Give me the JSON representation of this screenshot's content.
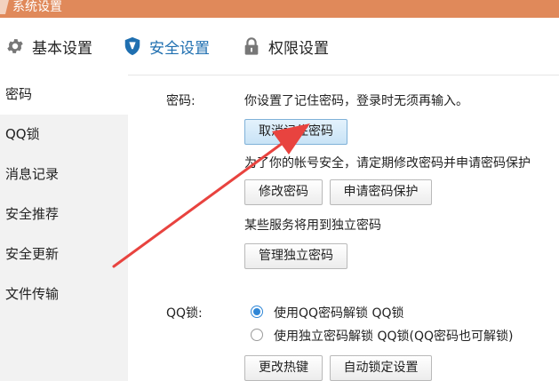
{
  "window": {
    "title": "系统设置"
  },
  "tabs": [
    {
      "label": "基本设置",
      "icon": "gear-icon"
    },
    {
      "label": "安全设置",
      "icon": "shield-icon",
      "active": true
    },
    {
      "label": "权限设置",
      "icon": "lock-icon"
    }
  ],
  "sidebar": {
    "items": [
      {
        "label": "密码",
        "active": true
      },
      {
        "label": "QQ锁"
      },
      {
        "label": "消息记录"
      },
      {
        "label": "安全推荐"
      },
      {
        "label": "安全更新"
      },
      {
        "label": "文件传输"
      }
    ]
  },
  "password": {
    "label": "密码:",
    "remembered_text": "你设置了记住密码，登录时无须再输入。",
    "cancel_remember_button": "取消记住密码",
    "security_tip": "为了你的帐号安全，请定期修改密码并申请密码保护",
    "change_password_button": "修改密码",
    "apply_protection_button": "申请密码保护",
    "independent_text": "某些服务将用到独立密码",
    "manage_independent_button": "管理独立密码"
  },
  "qqlock": {
    "label": "QQ锁:",
    "option1": "使用QQ密码解锁 QQ锁",
    "option2": "使用独立密码解锁 QQ锁(QQ密码也可解锁)",
    "selected": "option1",
    "hotkey_button": "更改热键",
    "autolock_button": "自动锁定设置"
  },
  "colors": {
    "titlebar": "#e0895a",
    "active_tab": "#1f6fb0",
    "annotation_arrow": "#e8433f",
    "radio_accent": "#2f86d6"
  }
}
